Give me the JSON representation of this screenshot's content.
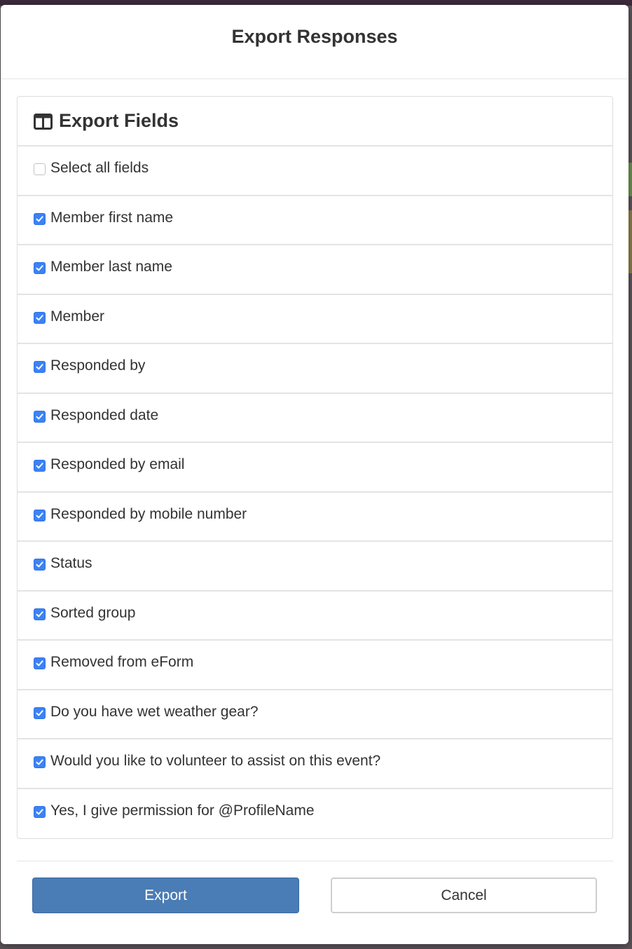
{
  "modal": {
    "title": "Export Responses"
  },
  "panel": {
    "title": "Export Fields",
    "icon": "columns-icon"
  },
  "select_all": {
    "label": "Select all fields",
    "checked": false
  },
  "fields": [
    {
      "label": "Member first name",
      "checked": true
    },
    {
      "label": "Member last name",
      "checked": true
    },
    {
      "label": "Member",
      "checked": true
    },
    {
      "label": "Responded by",
      "checked": true
    },
    {
      "label": "Responded date",
      "checked": true
    },
    {
      "label": "Responded by email",
      "checked": true
    },
    {
      "label": "Responded by mobile number",
      "checked": true
    },
    {
      "label": "Status",
      "checked": true
    },
    {
      "label": "Sorted group",
      "checked": true
    },
    {
      "label": "Removed from eForm",
      "checked": true
    },
    {
      "label": "Do you have wet weather gear?",
      "checked": true
    },
    {
      "label": "Would you like to volunteer to assist on this event?",
      "checked": true
    },
    {
      "label": "Yes, I give permission for @ProfileName",
      "checked": true
    }
  ],
  "footer": {
    "export_label": "Export",
    "cancel_label": "Cancel"
  },
  "colors": {
    "primary": "#4a7cb5",
    "checkbox": "#3b82f6"
  }
}
